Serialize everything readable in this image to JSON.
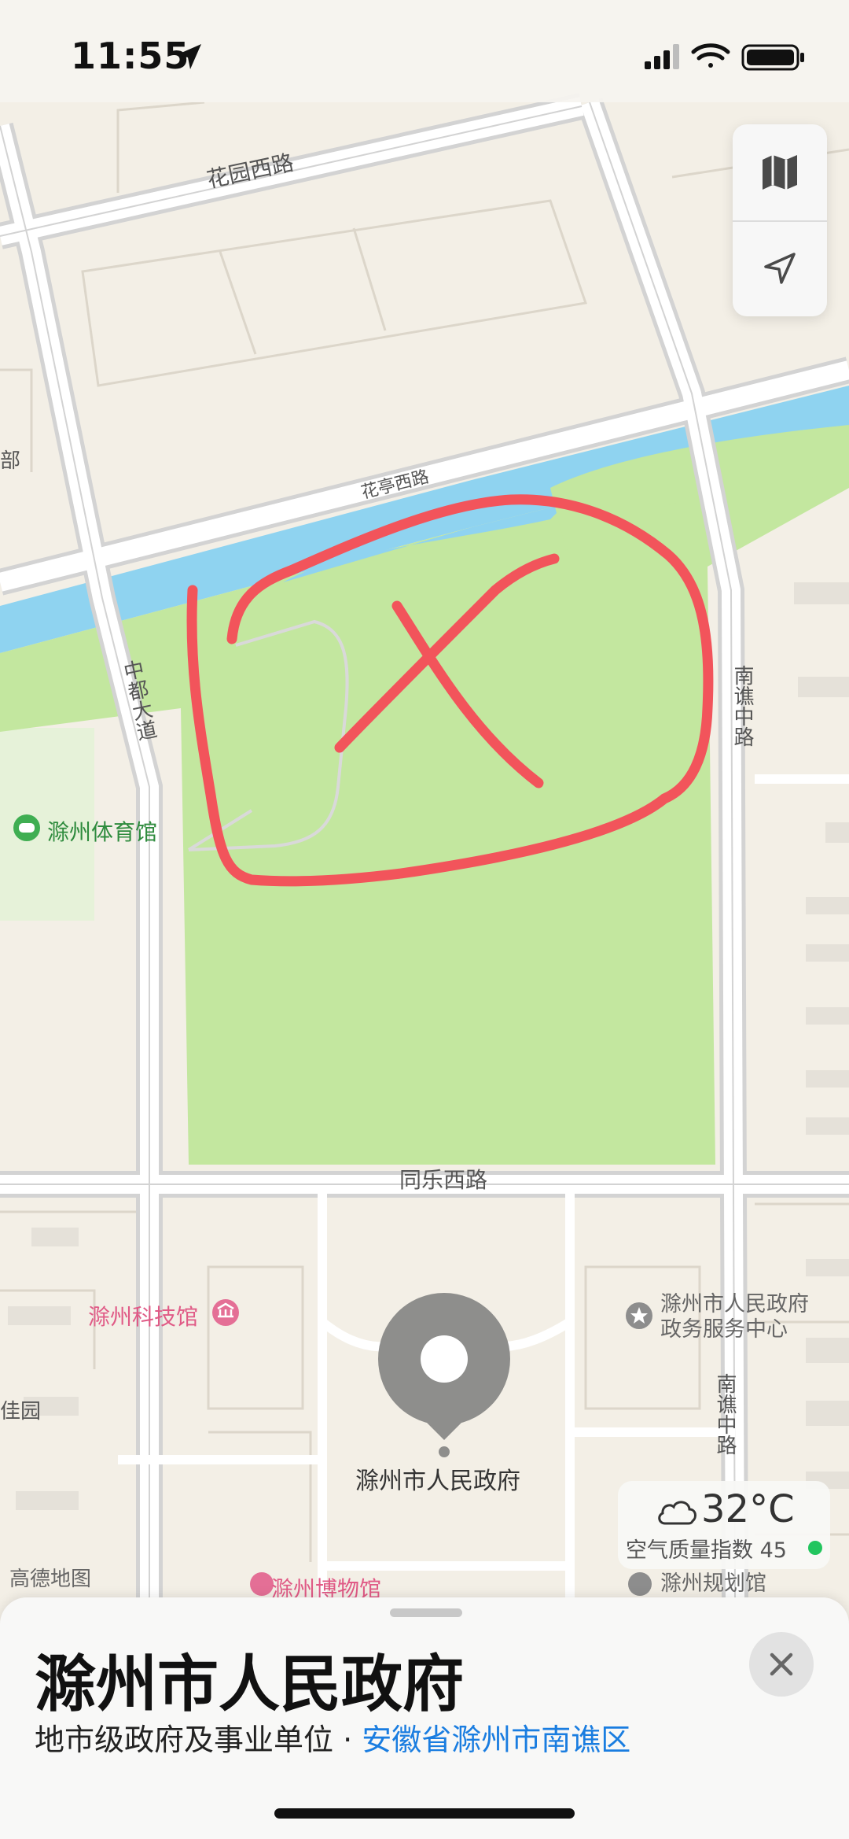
{
  "status_bar": {
    "time": "11:55",
    "icons": [
      "location-arrow-icon",
      "cellular-signal-icon",
      "wifi-icon",
      "battery-icon"
    ]
  },
  "map_controls": {
    "map_type_icon": "map-icon",
    "locate_icon": "location-arrow-icon"
  },
  "map": {
    "roads": {
      "huayuan": "花园西路",
      "huating": "花亭西路",
      "zhongdu": "中都大道",
      "nanqiao": "南谯中路",
      "nanqiao2": "南谯中路",
      "tongle": "同乐西路"
    },
    "edge_fragments": {
      "left_top": "部",
      "left_mid": "佳园"
    },
    "pois": {
      "stadium": "滁州体育馆",
      "science_museum": "滁州科技馆",
      "service_center_line1": "滁州市人民政府",
      "service_center_line2": "政务服务中心",
      "museum": "滁州博物馆",
      "planning_hall": "滁州规划馆",
      "selected_pin": "滁州市人民政府"
    },
    "watermark": "高德地图",
    "annotation": "red-hand-drawn-circle-with-x"
  },
  "weather": {
    "icon": "cloud-icon",
    "temperature": "32°C",
    "aqi_label": "空气质量指数 45",
    "aqi_color": "#22c55e"
  },
  "place_card": {
    "title": "滁州市人民政府",
    "category": "地市级政府及事业单位",
    "separator": " · ",
    "location": "安徽省滁州市南谯区",
    "close_icon": "close-icon"
  },
  "colors": {
    "park": "#c3e79f",
    "water": "#8fd3f0",
    "land": "#f3efe6",
    "road": "#ffffff",
    "road_outline": "#d6d6d6",
    "annotation": "#f2545b",
    "link": "#1a7de0"
  }
}
